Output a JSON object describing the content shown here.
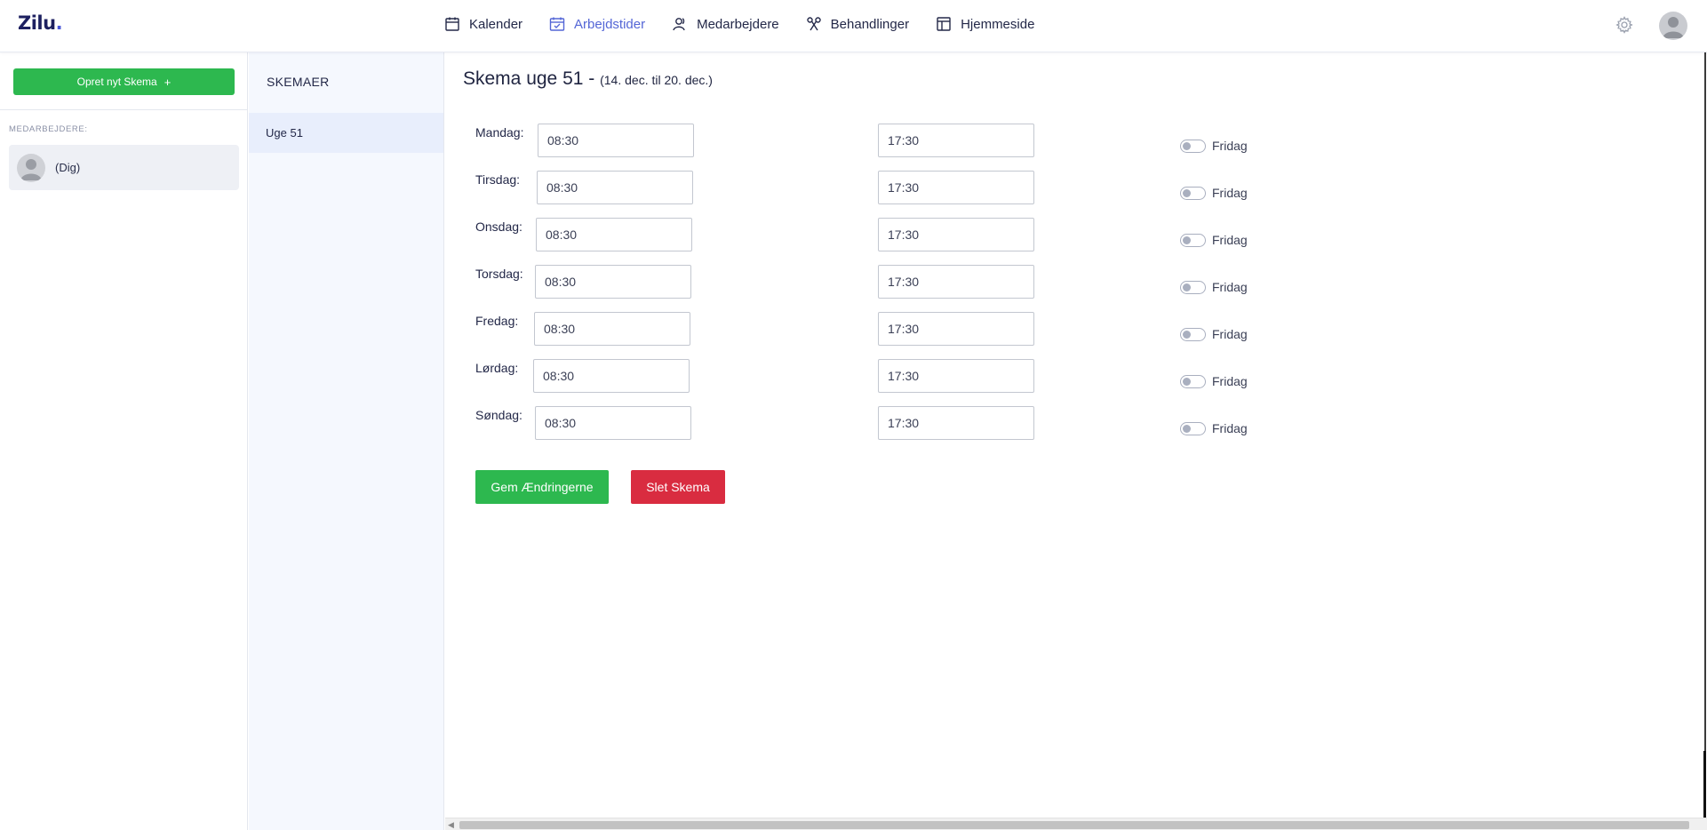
{
  "app": {
    "logo": "Zilu",
    "logo_dot": "."
  },
  "nav": [
    {
      "label": "Kalender",
      "icon": "calendar-icon",
      "active": false
    },
    {
      "label": "Arbejdstider",
      "icon": "schedule-icon",
      "active": true
    },
    {
      "label": "Medarbejdere",
      "icon": "users-icon",
      "active": false
    },
    {
      "label": "Behandlinger",
      "icon": "scissors-icon",
      "active": false
    },
    {
      "label": "Hjemmeside",
      "icon": "layout-icon",
      "active": false
    }
  ],
  "header": {
    "settings_icon": "gear-icon",
    "avatar_icon": "user-avatar-icon"
  },
  "sidebar": {
    "new_button_label": "Opret nyt Skema",
    "new_button_icon": "+",
    "section_label": "MEDARBEJDERE:",
    "employees": [
      {
        "name": "(Dig)"
      }
    ]
  },
  "schedules": {
    "title": "SKEMAER",
    "items": [
      {
        "label": "Uge 51",
        "selected": true
      }
    ]
  },
  "main": {
    "title": "Skema uge 51 -",
    "date_range": "(14. dec. til 20. dec.)",
    "days": [
      {
        "label": "Mandag:",
        "start": "08:30",
        "end": "17:30",
        "off_label": "Fridag",
        "off": false
      },
      {
        "label": "Tirsdag:",
        "start": "08:30",
        "end": "17:30",
        "off_label": "Fridag",
        "off": false
      },
      {
        "label": "Onsdag:",
        "start": "08:30",
        "end": "17:30",
        "off_label": "Fridag",
        "off": false
      },
      {
        "label": "Torsdag:",
        "start": "08:30",
        "end": "17:30",
        "off_label": "Fridag",
        "off": false
      },
      {
        "label": "Fredag:",
        "start": "08:30",
        "end": "17:30",
        "off_label": "Fridag",
        "off": false
      },
      {
        "label": "Lørdag:",
        "start": "08:30",
        "end": "17:30",
        "off_label": "Fridag",
        "off": false
      },
      {
        "label": "Søndag:",
        "start": "08:30",
        "end": "17:30",
        "off_label": "Fridag",
        "off": false
      }
    ],
    "save_label": "Gem Ændringerne",
    "delete_label": "Slet Skema"
  },
  "colors": {
    "accent": "#5466d6",
    "primary_green": "#2db84f",
    "danger_red": "#d92c40",
    "logo": "#1d2060"
  }
}
